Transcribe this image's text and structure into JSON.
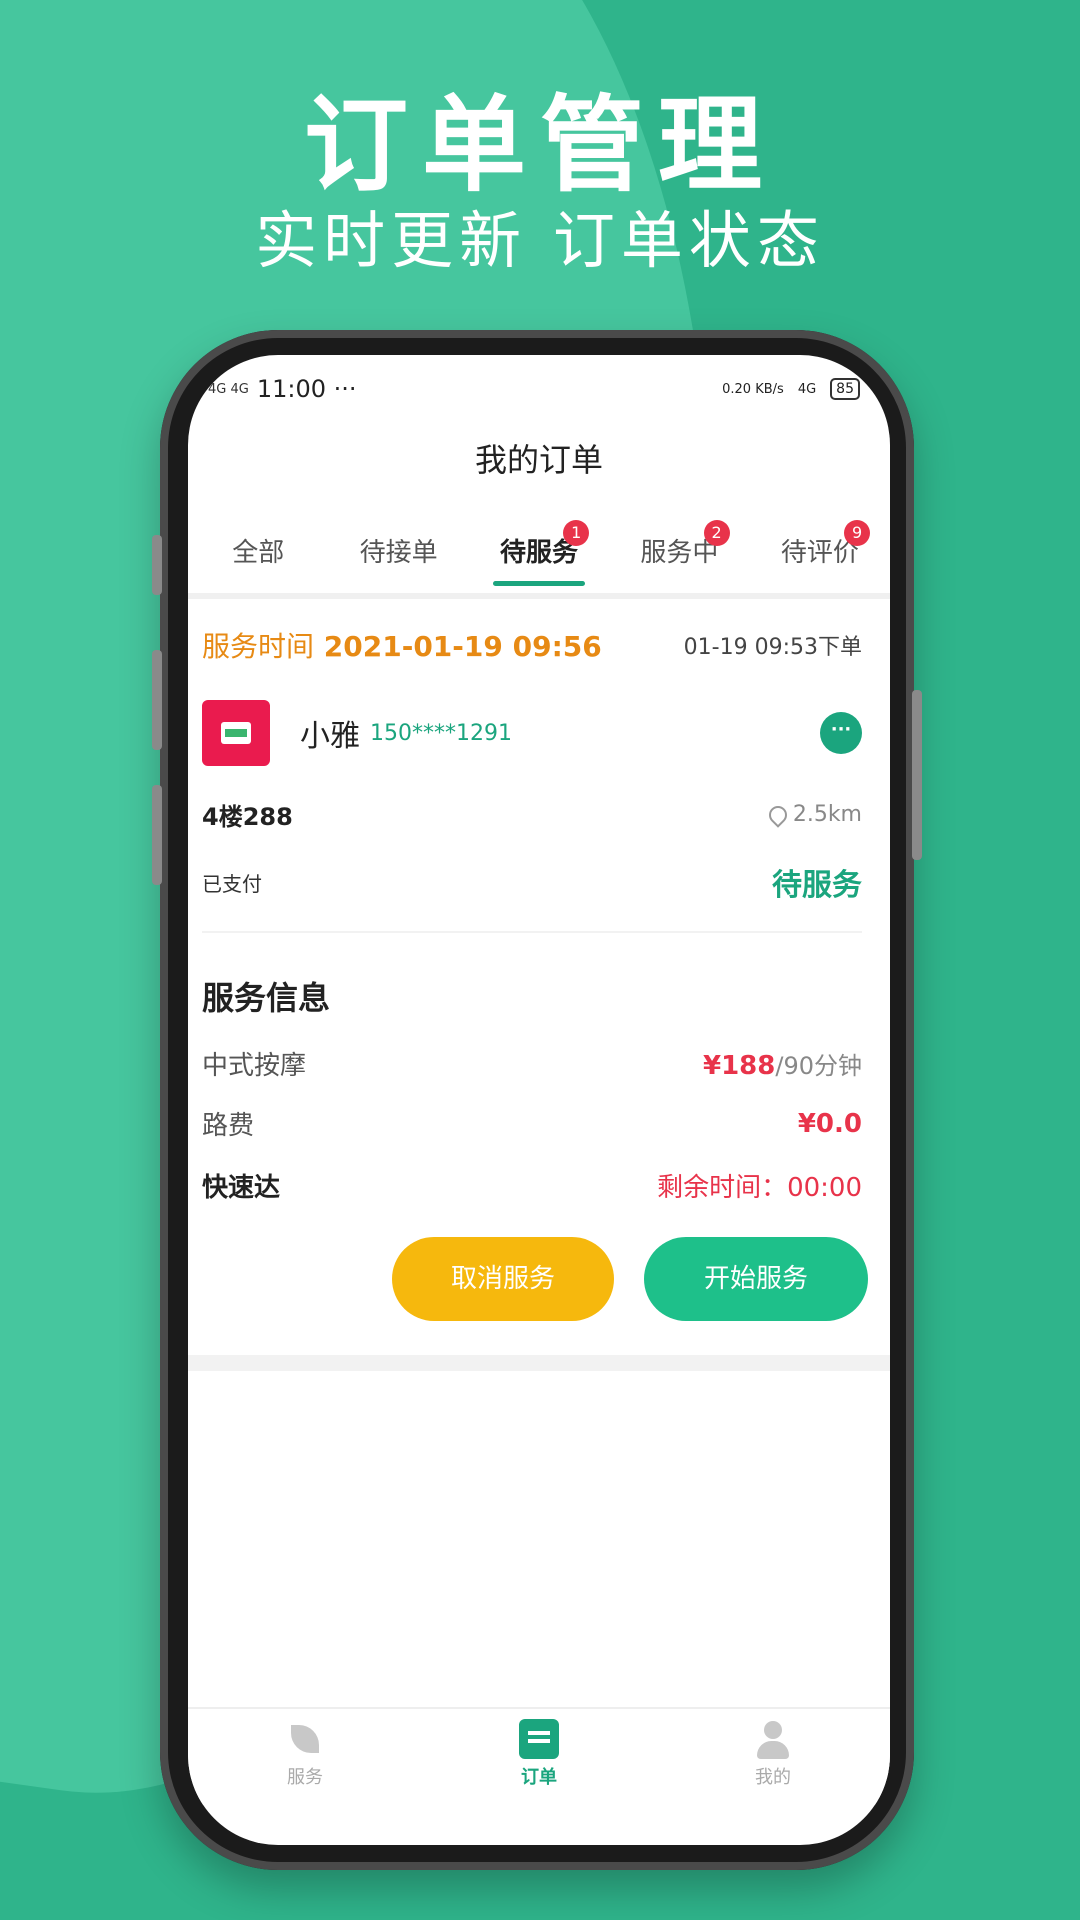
{
  "promo": {
    "title": "订单管理",
    "subtitle": "实时更新 订单状态"
  },
  "status_bar": {
    "time": "11:00 ···",
    "signals": "4G 4G",
    "speed": "0.20 KB/s",
    "network": "4G",
    "battery": "85"
  },
  "app": {
    "title": "我的订单"
  },
  "tabs": [
    {
      "label": "全部",
      "badge": ""
    },
    {
      "label": "待接单",
      "badge": ""
    },
    {
      "label": "待服务",
      "badge": "1"
    },
    {
      "label": "服务中",
      "badge": "2"
    },
    {
      "label": "待评价",
      "badge": "9"
    }
  ],
  "order": {
    "service_time_label": "服务时间",
    "service_time_value": "2021-01-19 09:56",
    "order_time": "01-19 09:53下单",
    "customer_name": "小雅",
    "customer_phone": "150****1291",
    "address": "4楼288",
    "distance": "2.5km",
    "pay_status": "已支付",
    "order_status": "待服务",
    "info_title": "服务信息",
    "service_name": "中式按摩",
    "service_price": "¥188",
    "service_unit": "/90分钟",
    "travel_fee_label": "路费",
    "travel_fee": "¥0.0",
    "express_label": "快速达",
    "remaining_time": "剩余时间：00:00",
    "cancel_label": "取消服务",
    "start_label": "开始服务"
  },
  "nav": [
    {
      "label": "服务",
      "icon": "leaf-icon"
    },
    {
      "label": "订单",
      "icon": "order-icon"
    },
    {
      "label": "我的",
      "icon": "user-icon"
    }
  ],
  "colors": {
    "brand_green": "#1ba57e",
    "background_green": "#2fb48b",
    "accent_orange": "#e78a14",
    "price_red": "#e8334a",
    "cancel_yellow": "#f6b80d"
  }
}
